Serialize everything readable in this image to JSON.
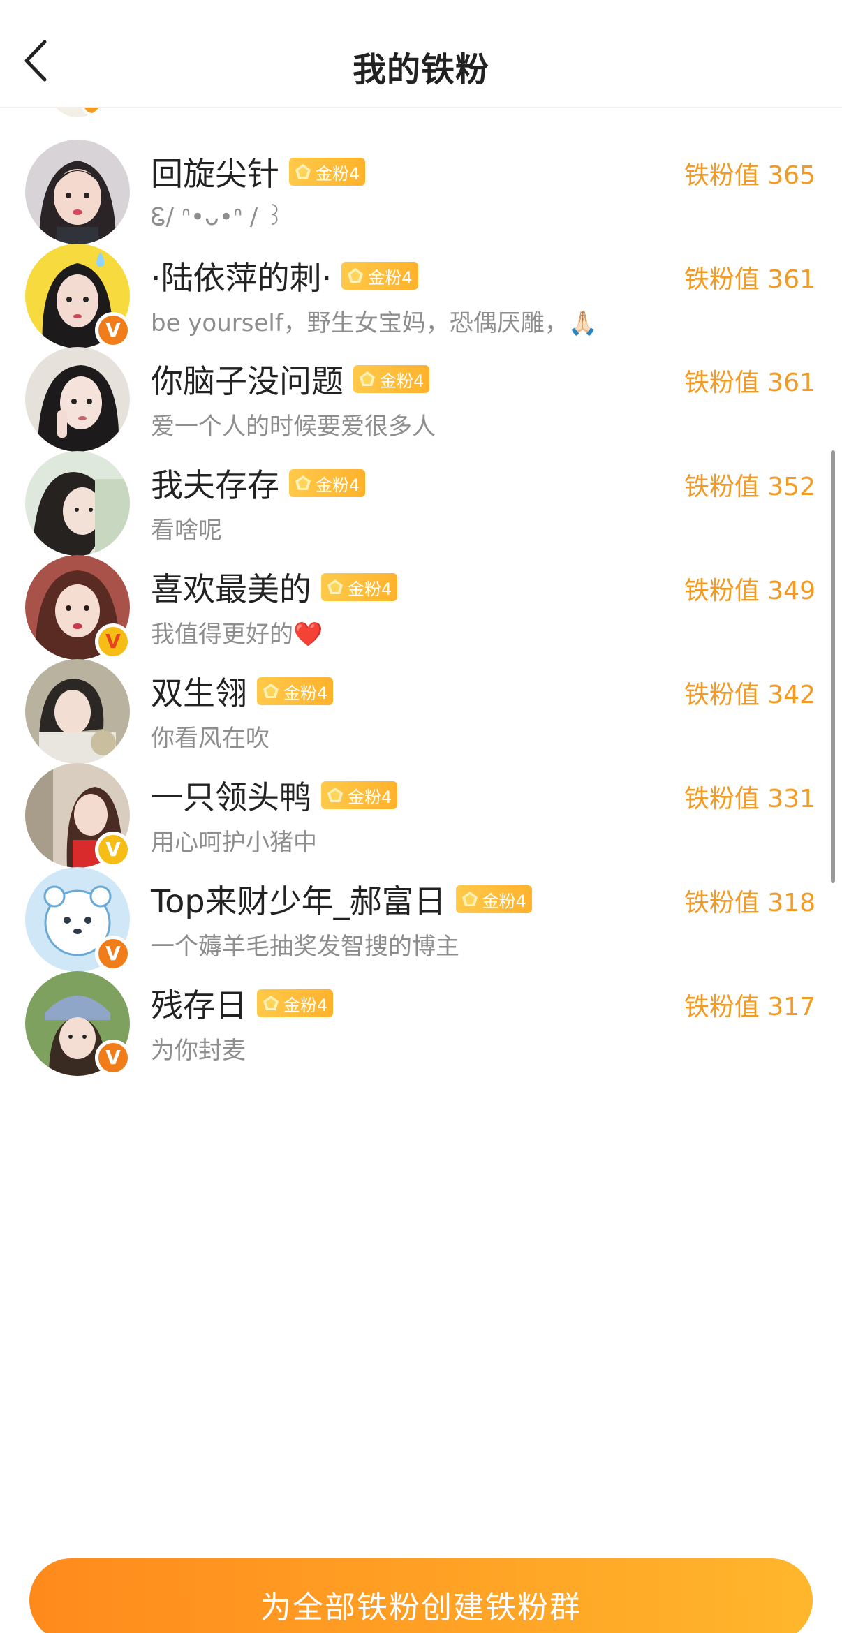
{
  "header": {
    "title": "我的铁粉",
    "back_icon": "chevron-left-icon"
  },
  "colors": {
    "accent": "#f39a22",
    "badge_bg": "#ffbe3b",
    "verify_orange": "#f07d1a",
    "verify_yellow": "#f6bd16"
  },
  "fans": [
    {
      "name": "回旋尖针",
      "badge": "金粉4",
      "bio": "Ꮛ/ ᐢ•ᴗ•ᐢ / ꒱",
      "score": "铁粉值 365",
      "verified": "none"
    },
    {
      "name": "·陆依萍的刺·",
      "badge": "金粉4",
      "bio": "be yourself，野生女宝妈，恐偶厌雕，🙏🏻",
      "score": "铁粉值 361",
      "verified": "orange"
    },
    {
      "name": "你脑子没问题",
      "badge": "金粉4",
      "bio": "爱一个人的时候要爱很多人",
      "score": "铁粉值 361",
      "verified": "none"
    },
    {
      "name": "我夫存存",
      "badge": "金粉4",
      "bio": "看啥呢",
      "score": "铁粉值 352",
      "verified": "none"
    },
    {
      "name": "喜欢最美的",
      "badge": "金粉4",
      "bio": "我值得更好的❤️",
      "score": "铁粉值 349",
      "verified": "yellow"
    },
    {
      "name": "双生翎",
      "badge": "金粉4",
      "bio": "你看风在吹",
      "score": "铁粉值 342",
      "verified": "none"
    },
    {
      "name": "一只领头鸭",
      "badge": "金粉4",
      "bio": "用心呵护小猪中",
      "score": "铁粉值 331",
      "verified": "yellow"
    },
    {
      "name": "Top来财少年_郝富日",
      "badge": "金粉4",
      "bio": "一个薅羊毛抽奖发智搜的博主",
      "score": "铁粉值 318",
      "verified": "orange"
    },
    {
      "name": "残存日",
      "badge": "金粉4",
      "bio": "为你封麦",
      "score": "铁粉值 317",
      "verified": "orange"
    }
  ],
  "verify_label": "V",
  "cta": {
    "label": "为全部铁粉创建铁粉群"
  }
}
